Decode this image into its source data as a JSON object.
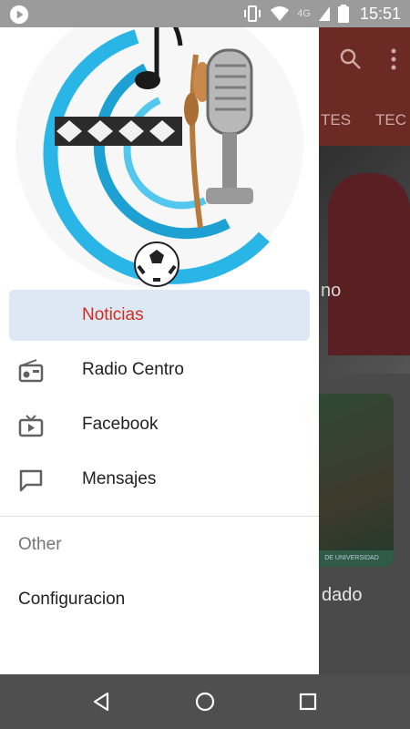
{
  "status_bar": {
    "time": "15:51",
    "network": "4G",
    "icons": [
      "play-circle-icon",
      "vibrate-icon",
      "wifi-icon",
      "signal-icon",
      "battery-icon"
    ]
  },
  "app_background": {
    "tabs": [
      "TES",
      "TEC"
    ],
    "hero_caption": "no",
    "card_stripe_text": "DE UNIVERSIDAD",
    "card_caption": "dado",
    "toolbar_icons": [
      "search-icon",
      "more-vert-icon"
    ],
    "accent_color": "#b83a2e"
  },
  "drawer": {
    "menu_items": [
      {
        "label": "Noticias",
        "icon": "",
        "active": true
      },
      {
        "label": "Radio Centro",
        "icon": "radio-icon",
        "active": false
      },
      {
        "label": "Facebook",
        "icon": "tv-icon",
        "active": false
      },
      {
        "label": "Mensajes",
        "icon": "chat-bubble-icon",
        "active": false
      }
    ],
    "section_title": "Other",
    "settings_label": "Configuracion",
    "active_color": "#d62b1f",
    "active_bg": "#dde8f5"
  },
  "nav_bar": {
    "buttons": [
      "back-icon",
      "home-icon",
      "recents-icon"
    ]
  }
}
